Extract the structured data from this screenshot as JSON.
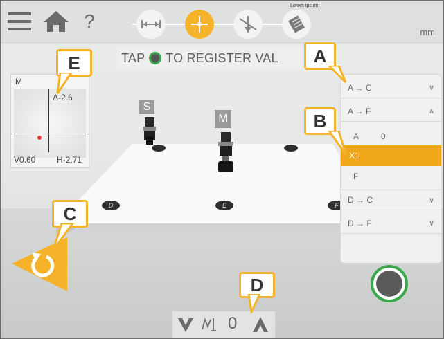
{
  "toolbar": {
    "menu_icon": "hamburger-icon",
    "home_icon": "home-icon",
    "help_label": "?",
    "unit": "mm",
    "tiny_text": "Lorem ipsum"
  },
  "steps": [
    {
      "name": "distance",
      "icon": "distance-arrows-icon"
    },
    {
      "name": "measure",
      "icon": "crosshair-icon"
    },
    {
      "name": "adjust",
      "icon": "adjust-icon"
    },
    {
      "name": "report",
      "icon": "report-icon"
    }
  ],
  "banner": {
    "prefix": "TAP",
    "suffix": "TO REGISTER VAL"
  },
  "minimap": {
    "label": "M",
    "delta": "Δ-2.6",
    "v_value": "V0.60",
    "h_value": "H-2.71"
  },
  "scene": {
    "label_s": "S",
    "label_m": "M",
    "disc_d": "D",
    "disc_e": "E",
    "disc_f": "F"
  },
  "panel": {
    "rows": [
      {
        "label": "A → C",
        "chevron": "∨"
      },
      {
        "label": "A → F",
        "chevron": "∧"
      },
      {
        "label": "A",
        "value": "0"
      },
      {
        "label": "X1",
        "value": ""
      },
      {
        "label": "F",
        "value": ""
      },
      {
        "label": "D → C",
        "chevron": "∨"
      },
      {
        "label": "D → F",
        "chevron": "∨"
      }
    ]
  },
  "bottom": {
    "value": "0"
  },
  "callouts": {
    "a": "A",
    "b": "B",
    "c": "C",
    "d": "D",
    "e": "E"
  },
  "colors": {
    "accent": "#f5b32b",
    "selected_row": "#f0a818",
    "register_ring": "#3aa84a"
  }
}
